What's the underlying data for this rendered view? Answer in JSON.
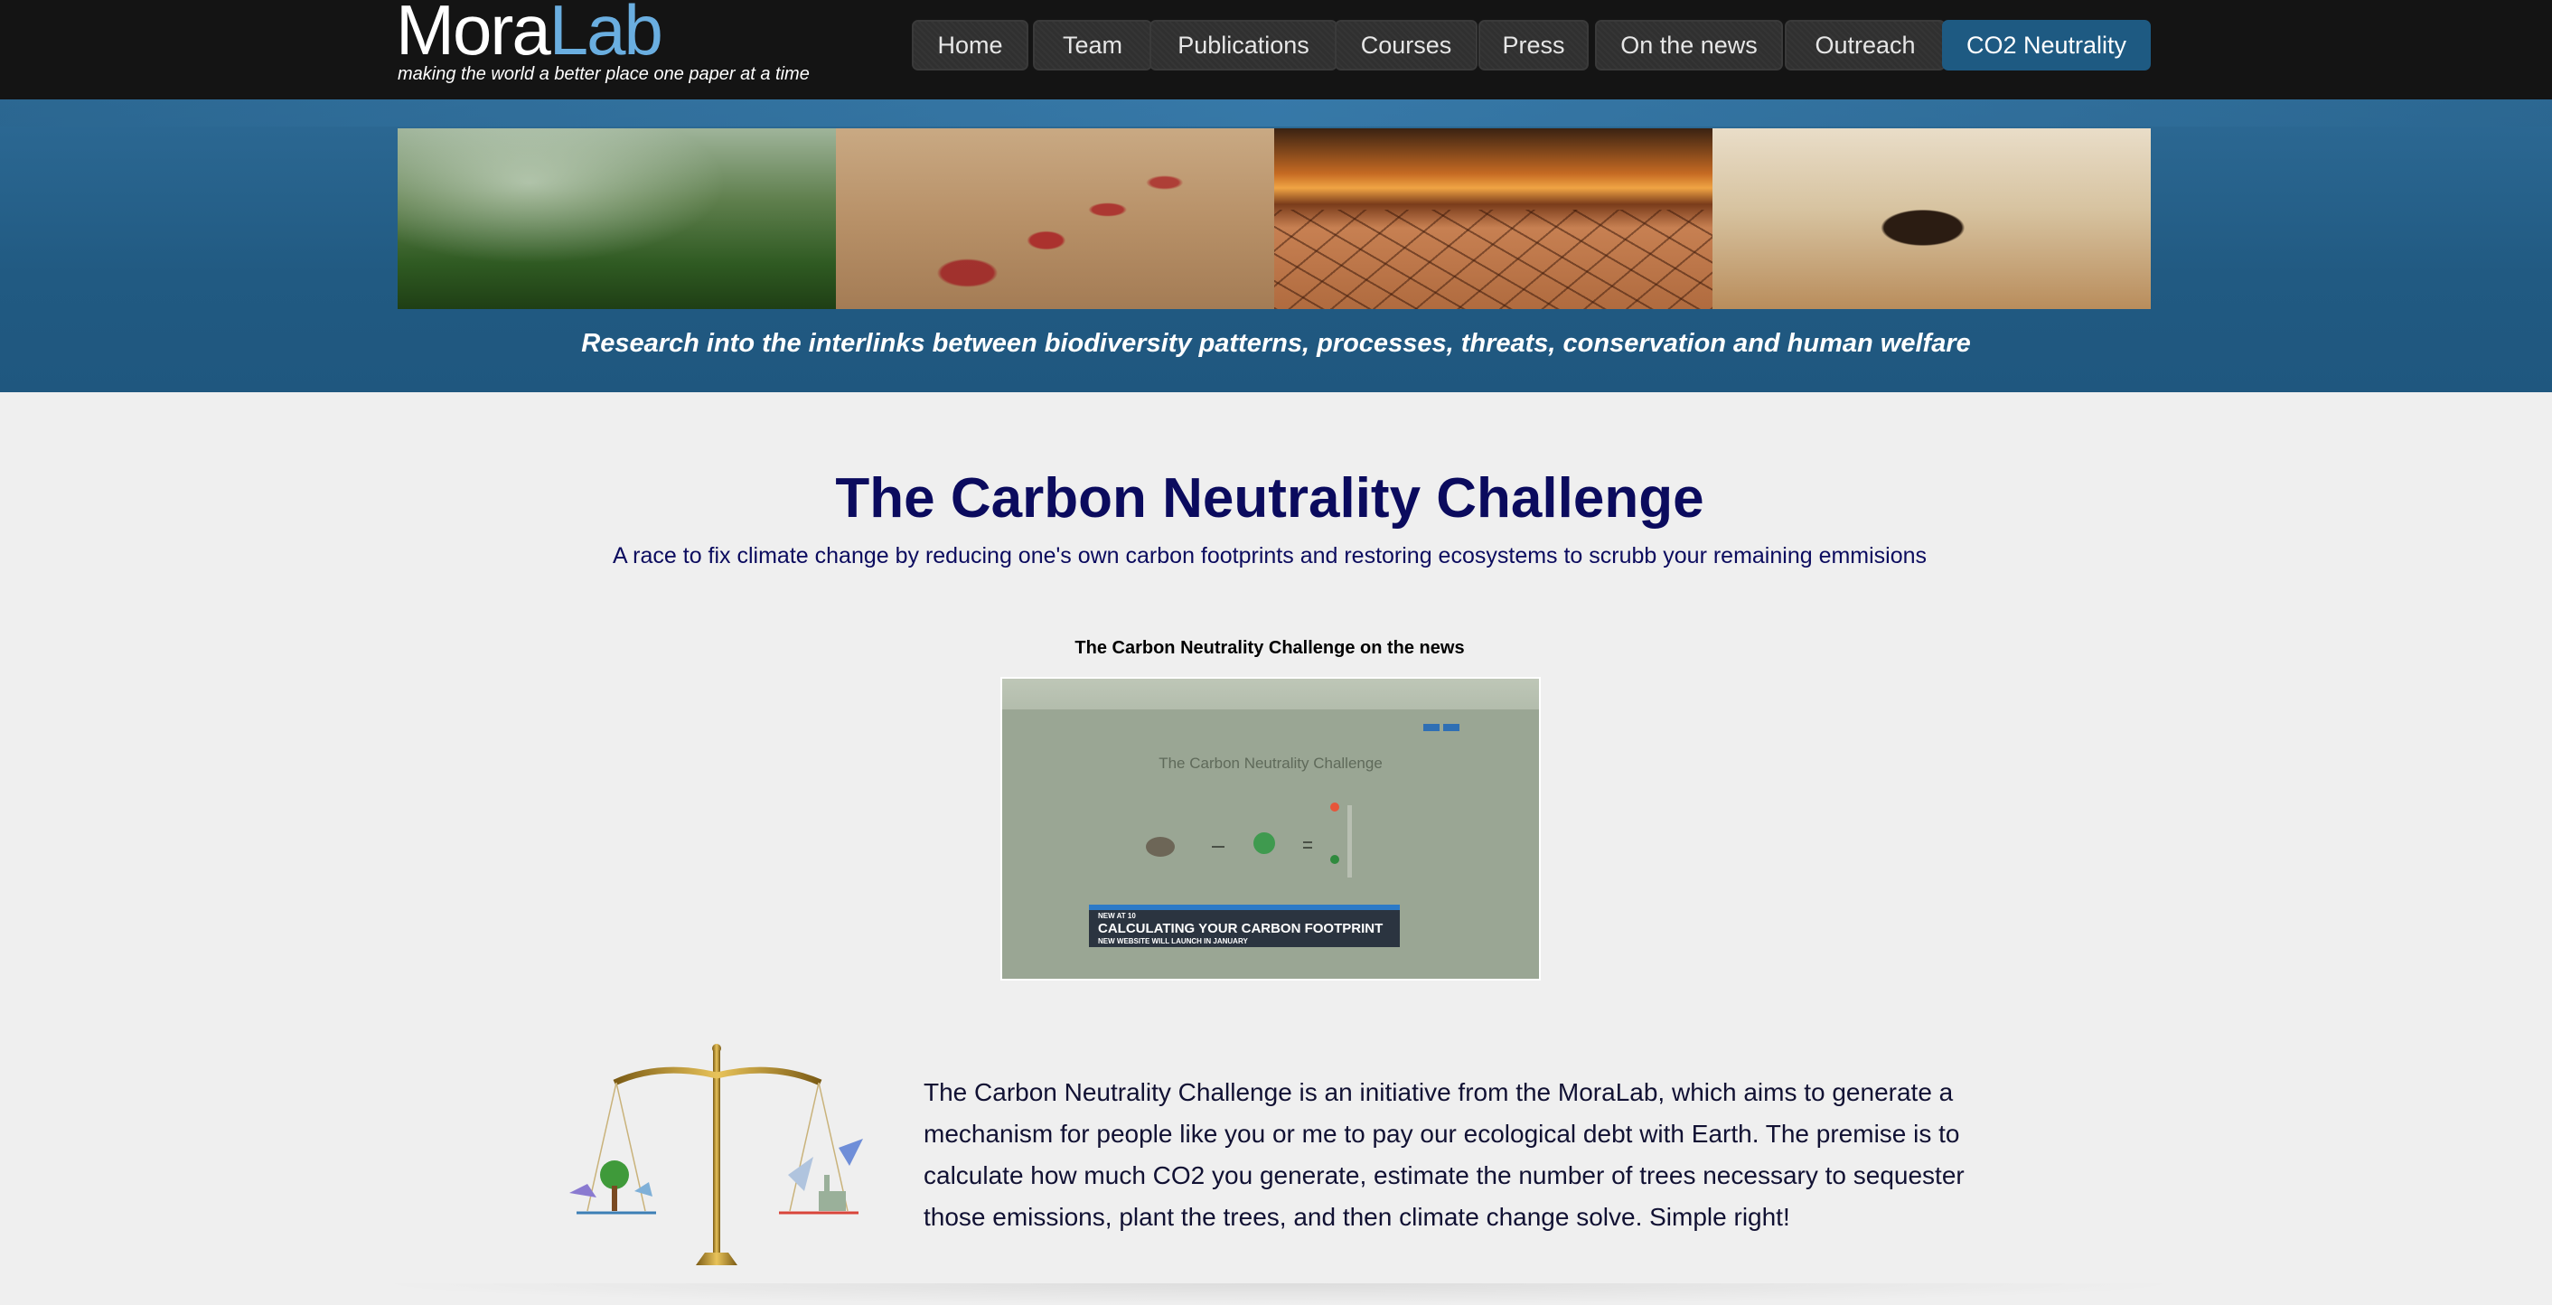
{
  "header": {
    "logo_part1": "Mora",
    "logo_part2": "Lab",
    "tagline": "making the world a better place one paper at a time"
  },
  "nav": {
    "items": [
      {
        "label": "Home"
      },
      {
        "label": "Team"
      },
      {
        "label": "Publications"
      },
      {
        "label": "Courses"
      },
      {
        "label": "Press"
      },
      {
        "label": "On the news"
      },
      {
        "label": "Outreach"
      },
      {
        "label": "CO2 Neutrality",
        "active": true
      }
    ]
  },
  "banner": {
    "caption": "Research into the interlinks between biodiversity patterns, processes, threats, conservation and human welfare"
  },
  "main": {
    "title": "The Carbon Neutrality Challenge",
    "subtitle": "A race to fix climate change by reducing one's own carbon footprints and restoring ecosystems to scrubb your remaining emmisions",
    "video": {
      "caption": "The Carbon Neutrality Challenge on the news",
      "screen_heading": "The Carbon Neutrality Challenge",
      "lower_third_kicker": "NEW AT 10",
      "lower_third_headline": "CALCULATING YOUR CARBON FOOTPRINT",
      "lower_third_sub": "NEW WEBSITE WILL LAUNCH IN JANUARY"
    },
    "intro_text": "The Carbon Neutrality Challenge is an initiative from the MoraLab, which aims to generate a mechanism for people like you or me to pay our ecological debt with Earth. The premise is to calculate how much CO2 you generate, estimate the number of trees necessary to sequester those emissions, plant the trees, and then climate change solve. Simple right!"
  },
  "colors": {
    "header_bg": "#141414",
    "logo_accent": "#6aaee0",
    "nav_active": "#1e5a82",
    "banner_bg": "#215a82",
    "title_color": "#0b0b5e",
    "page_bg": "#efefef"
  }
}
